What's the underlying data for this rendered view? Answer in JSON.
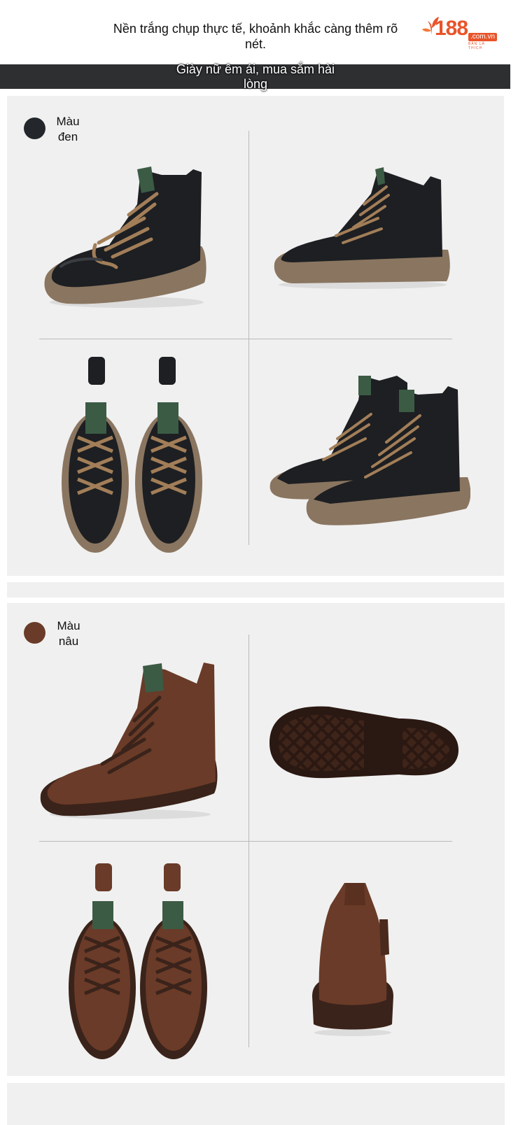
{
  "header": {
    "description": "Nền trắng chụp thực tế, khoảnh khắc càng thêm rõ nét.",
    "logo_number": "188",
    "logo_domain": ".com.vn",
    "logo_tagline": "BÁN LÀ THÍCH",
    "logo_color": "#e8542a"
  },
  "banner": {
    "text": "Giày nữ êm ái, mua sắm hài lòng",
    "background": "#2d2f31"
  },
  "variants": [
    {
      "label": "Màu đen",
      "swatch_color": "#23262b",
      "images": [
        "black-boot-side-left",
        "black-boot-side-right",
        "black-boots-top-view",
        "black-boots-pair-angle"
      ]
    },
    {
      "label": "Màu nâu",
      "swatch_color": "#6a3b28",
      "images": [
        "brown-boot-side",
        "brown-boot-sole",
        "brown-boots-top-view",
        "brown-boot-back"
      ]
    }
  ]
}
